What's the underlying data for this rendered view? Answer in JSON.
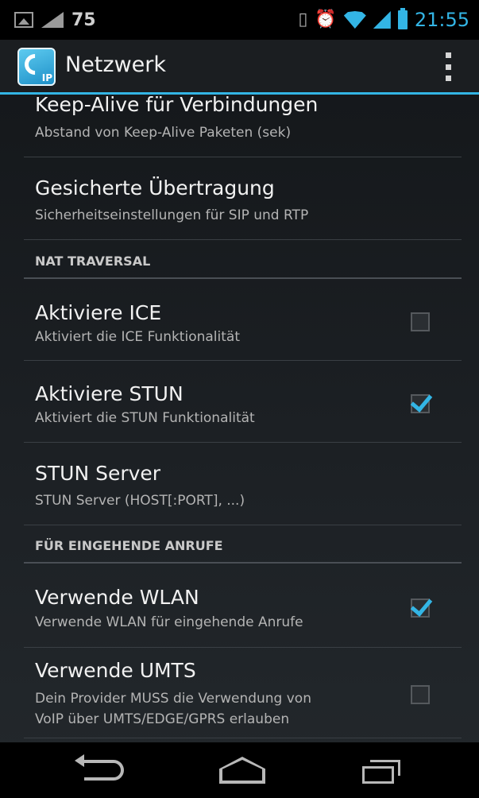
{
  "status_bar": {
    "notification_count": "75",
    "time": "21:55"
  },
  "action_bar": {
    "title": "Netzwerk",
    "app_icon_label": "IP"
  },
  "preferences": [
    {
      "kind": "pref",
      "title": "Keep-Alive für Verbindungen",
      "summary": "Abstand von Keep-Alive Paketen (sek)"
    },
    {
      "kind": "pref",
      "title": "Gesicherte Übertragung",
      "summary": "Sicherheitseinstellungen für SIP und RTP"
    },
    {
      "kind": "category",
      "label": "NAT TRAVERSAL"
    },
    {
      "kind": "check",
      "title": "Aktiviere ICE",
      "summary": "Aktiviert die ICE Funktionalität",
      "checked": false
    },
    {
      "kind": "check",
      "title": "Aktiviere STUN",
      "summary": "Aktiviert die STUN Funktionalität",
      "checked": true
    },
    {
      "kind": "pref",
      "title": "STUN Server",
      "summary": "STUN Server (HOST[:PORT], ...)"
    },
    {
      "kind": "category",
      "label": "FÜR EINGEHENDE ANRUFE"
    },
    {
      "kind": "check",
      "title": "Verwende WLAN",
      "summary": "Verwende WLAN für eingehende Anrufe",
      "checked": true
    },
    {
      "kind": "check",
      "title": "Verwende UMTS",
      "summary_lines": [
        "Dein Provider MUSS die Verwendung von",
        "VoIP über UMTS/EDGE/GPRS erlauben"
      ],
      "checked": false
    }
  ],
  "colors": {
    "accent": "#33b5e5",
    "background_top": "#131619",
    "background_bottom": "#23282c"
  }
}
